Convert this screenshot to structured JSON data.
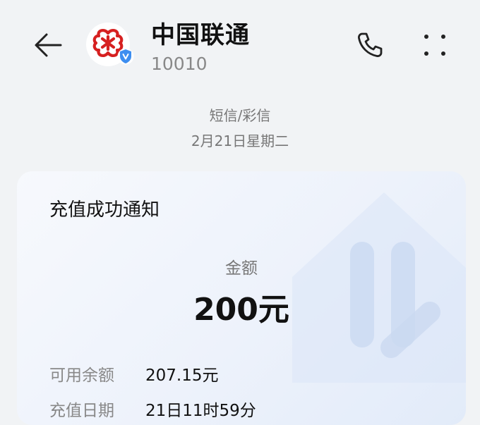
{
  "header": {
    "contact_name": "中国联通",
    "contact_number": "10010"
  },
  "icons": {
    "back": "back-arrow-icon",
    "avatar": "china-unicom-logo",
    "verified": "verified-badge-icon",
    "call": "phone-icon",
    "more": "more-dots-icon"
  },
  "colors": {
    "logo_red": "#d62020",
    "verified_blue": "#3d8ef0",
    "card_tint": "#e2ebf9"
  },
  "thread": {
    "type": "短信/彩信",
    "date": "2月21日星期二"
  },
  "card": {
    "title": "充值成功通知",
    "amount_label": "金额",
    "amount_value": "200元",
    "rows": [
      {
        "label": "可用余额",
        "value": "207.15元"
      },
      {
        "label": "充值日期",
        "value": "21日11时59分"
      }
    ]
  }
}
